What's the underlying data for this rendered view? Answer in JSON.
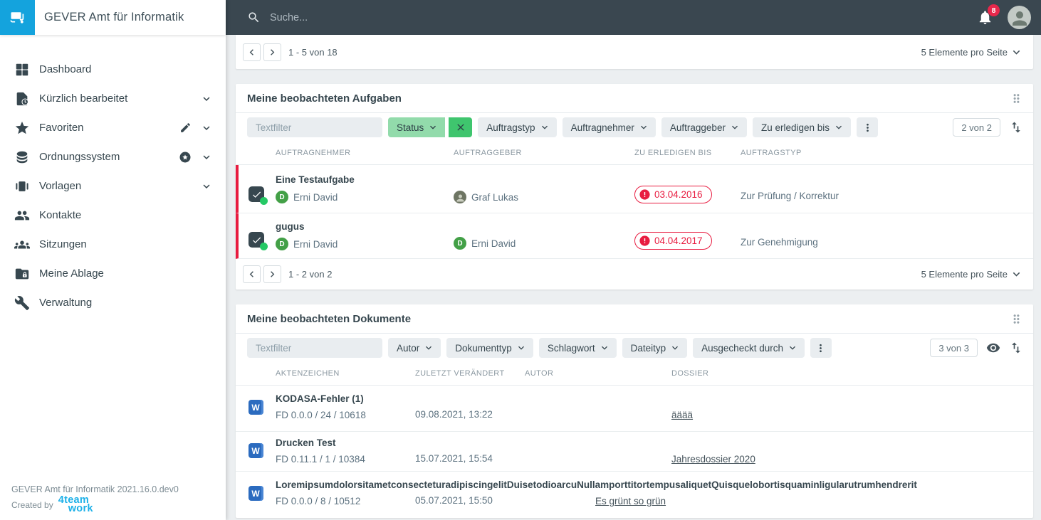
{
  "colors": {
    "accent_blue": "#14a3dd",
    "topbar_bg": "#3a4750",
    "danger_red": "#e81c40",
    "filter_active_bg": "#92dbab",
    "filter_clear_bg": "#3fc56e",
    "avatar_green": "#43a047",
    "state_dot_green": "#25c965",
    "vendor_cyan": "#1cb0e8",
    "word_icon_blue": "#2b6bbf"
  },
  "app": {
    "title": "GEVER Amt für Informatik",
    "footer_version": "GEVER Amt für Informatik 2021.16.0.dev0",
    "footer_created_by": "Created by",
    "vendor_logo_line1": "4team",
    "vendor_logo_line2": "work"
  },
  "header": {
    "search_placeholder": "Suche...",
    "notification_count": "8"
  },
  "sidebar": {
    "items": [
      {
        "label": "Dashboard"
      },
      {
        "label": "Kürzlich bearbeitet"
      },
      {
        "label": "Favoriten"
      },
      {
        "label": "Ordnungssystem"
      },
      {
        "label": "Vorlagen"
      },
      {
        "label": "Kontakte"
      },
      {
        "label": "Sitzungen"
      },
      {
        "label": "Meine Ablage"
      },
      {
        "label": "Verwaltung"
      }
    ]
  },
  "content": {
    "top_pager": {
      "range": "1 - 5 von 18",
      "per_page": "5 Elemente pro Seite"
    },
    "tasks": {
      "title": "Meine beobachteten Aufgaben",
      "textfilter_placeholder": "Textfilter",
      "active_filter_label": "Status",
      "filters": [
        "Auftragstyp",
        "Auftragnehmer",
        "Auftraggeber",
        "Zu erledigen bis"
      ],
      "result_count": "2 von 2",
      "columns": [
        "AUFTRAGNEHMER",
        "AUFTRAGGEBER",
        "ZU ERLEDIGEN BIS",
        "AUFTRAGSTYP"
      ],
      "rows": [
        {
          "title": "Eine Testaufgabe",
          "assignee": "Erni David",
          "assignee_initial": "D",
          "issuer": "Graf Lukas",
          "due": "03.04.2016",
          "type": "Zur Prüfung / Korrektur"
        },
        {
          "title": "gugus",
          "assignee": "Erni David",
          "assignee_initial": "D",
          "issuer": "Erni David",
          "issuer_initial": "D",
          "due": "04.04.2017",
          "type": "Zur Genehmigung"
        }
      ],
      "pager": {
        "range": "1 - 2 von 2",
        "per_page": "5 Elemente pro Seite"
      }
    },
    "documents": {
      "title": "Meine beobachteten Dokumente",
      "textfilter_placeholder": "Textfilter",
      "filters": [
        "Autor",
        "Dokumenttyp",
        "Schlagwort",
        "Dateityp",
        "Ausgecheckt durch"
      ],
      "result_count": "3 von 3",
      "columns": [
        "AKTENZEICHEN",
        "ZULETZT VERÄNDERT",
        "AUTOR",
        "DOSSIER"
      ],
      "word_glyph": "W",
      "rows": [
        {
          "title": "KODASA-Fehler (1)",
          "reference": "FD 0.0.0 / 24 / 10618",
          "modified": "09.08.2021, 13:22",
          "author": "",
          "dossier": "ääää"
        },
        {
          "title": "Drucken Test",
          "reference": "FD 0.11.1 / 1 / 10384",
          "modified": "15.07.2021, 15:54",
          "author": "",
          "dossier": "Jahresdossier 2020"
        },
        {
          "title": "LoremipsumdolorsitametconsecteturadipiscingelitDuisetodioarcuNullamporttitortempusaliquetQuisquelobortisquaminligularutrumhendrerit",
          "reference": "FD 0.0.0 / 8 / 10512",
          "modified": "05.07.2021, 15:50",
          "author": "",
          "dossier": "Es grünt so grün"
        }
      ]
    }
  }
}
